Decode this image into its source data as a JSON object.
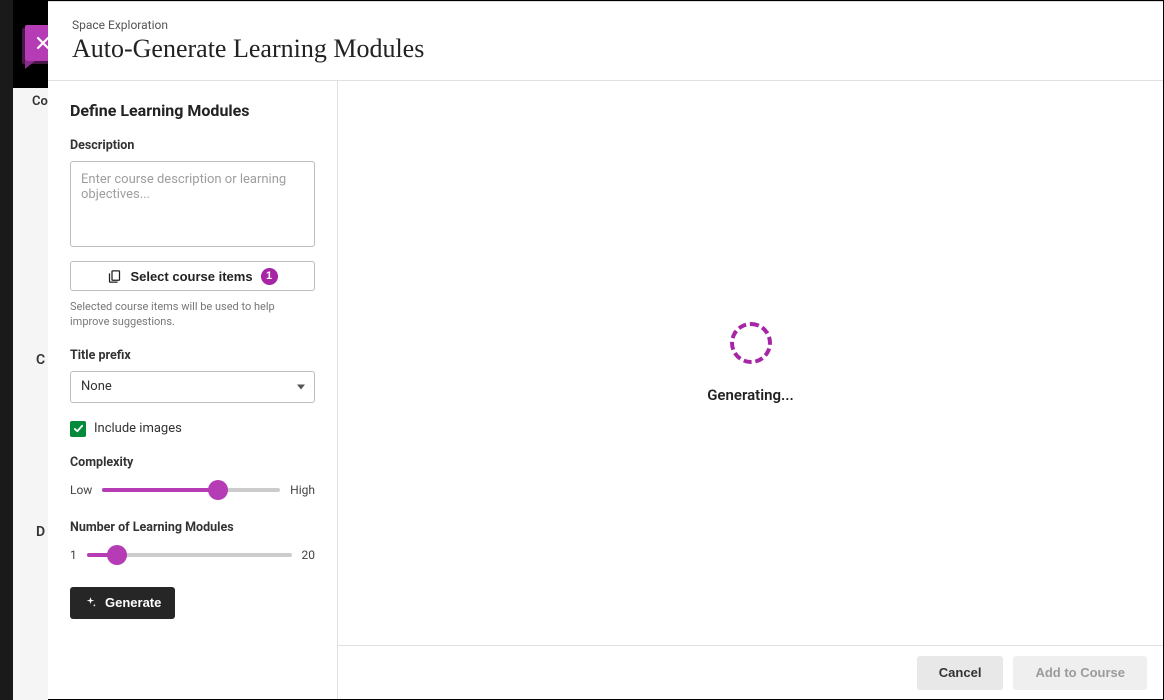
{
  "backdrop": {
    "tab_truncated": "Co",
    "letter_c": "C",
    "letter_d": "D"
  },
  "header": {
    "course_name": "Space Exploration",
    "title": "Auto-Generate Learning Modules"
  },
  "panel": {
    "section_title": "Define Learning Modules",
    "description_label": "Description",
    "description_placeholder": "Enter course description or learning objectives...",
    "select_items_button": "Select course items",
    "selected_count": "1",
    "select_items_help": "Selected course items will be used to help improve suggestions.",
    "title_prefix_label": "Title prefix",
    "title_prefix_value": "None",
    "include_images_label": "Include images",
    "complexity_label": "Complexity",
    "complexity_low": "Low",
    "complexity_high": "High",
    "modules_label": "Number of Learning Modules",
    "modules_min": "1",
    "modules_max": "20",
    "generate_button": "Generate"
  },
  "main": {
    "generating_text": "Generating..."
  },
  "footer": {
    "cancel": "Cancel",
    "add": "Add to Course"
  }
}
